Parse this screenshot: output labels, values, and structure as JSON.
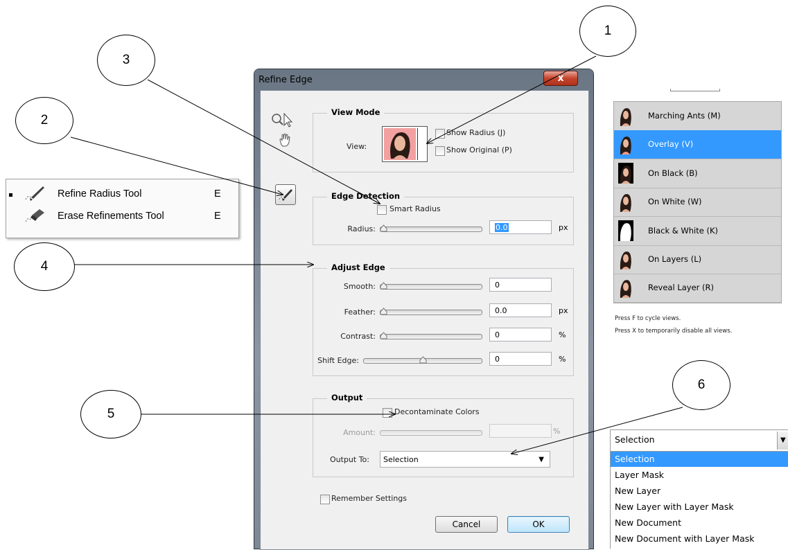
{
  "callouts": [
    "1",
    "2",
    "3",
    "4",
    "5",
    "6"
  ],
  "dialog": {
    "title": "Refine Edge",
    "close_glyph": "x",
    "view_mode": {
      "heading": "View Mode",
      "view_label": "View:",
      "show_radius": "Show Radius (J)",
      "show_original": "Show Original (P)"
    },
    "edge_detection": {
      "heading": "Edge Detection",
      "smart_radius": "Smart Radius",
      "radius_label": "Radius:",
      "radius_value": "0.0",
      "radius_unit": "px"
    },
    "adjust_edge": {
      "heading": "Adjust Edge",
      "smooth_label": "Smooth:",
      "smooth_value": "0",
      "feather_label": "Feather:",
      "feather_value": "0.0",
      "feather_unit": "px",
      "contrast_label": "Contrast:",
      "contrast_value": "0",
      "contrast_unit": "%",
      "shift_label": "Shift Edge:",
      "shift_value": "0",
      "shift_unit": "%"
    },
    "output": {
      "heading": "Output",
      "decontaminate": "Decontaminate Colors",
      "amount_label": "Amount:",
      "amount_unit": "%",
      "output_to_label": "Output To:",
      "output_to_value": "Selection"
    },
    "remember": "Remember Settings",
    "cancel": "Cancel",
    "ok": "OK"
  },
  "tool_popup": {
    "items": [
      {
        "label": "Refine Radius Tool",
        "key": "E",
        "icon": "brush-icon",
        "active": true
      },
      {
        "label": "Erase Refinements Tool",
        "key": "E",
        "icon": "eraser-icon",
        "active": false
      }
    ]
  },
  "view_panel": {
    "items": [
      {
        "label": "Marching Ants (M)",
        "selected": false
      },
      {
        "label": "Overlay (V)",
        "selected": true
      },
      {
        "label": "On Black (B)",
        "selected": false
      },
      {
        "label": "On White (W)",
        "selected": false
      },
      {
        "label": "Black & White (K)",
        "selected": false
      },
      {
        "label": "On Layers (L)",
        "selected": false
      },
      {
        "label": "Reveal Layer (R)",
        "selected": false
      }
    ],
    "hint1": "Press F to cycle views.",
    "hint2": "Press X to temporarily disable all views."
  },
  "output_dropdown": {
    "value": "Selection",
    "options": [
      "Selection",
      "Layer Mask",
      "New Layer",
      "New Layer with Layer Mask",
      "New Document",
      "New Document with Layer Mask"
    ],
    "selected_index": 0
  },
  "colors": {
    "selection_blue": "#3399ff",
    "close_red": "#c5442c"
  }
}
